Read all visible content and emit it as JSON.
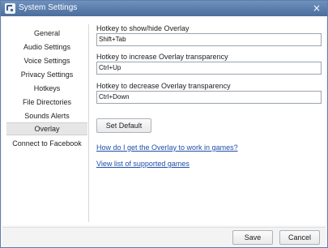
{
  "window": {
    "title": "System Settings",
    "close_glyph": "×",
    "app_icon": "app-logo-icon"
  },
  "sidebar": {
    "items": [
      {
        "label": "General"
      },
      {
        "label": "Audio Settings"
      },
      {
        "label": "Voice Settings"
      },
      {
        "label": "Privacy Settings"
      },
      {
        "label": "Hotkeys"
      },
      {
        "label": "File Directories"
      },
      {
        "label": "Sounds Alerts"
      },
      {
        "label": "Overlay"
      },
      {
        "label": "Connect to Facebook"
      }
    ],
    "selected": "Overlay"
  },
  "overlay": {
    "show_hide_label": "Hotkey to show/hide Overlay",
    "show_hide_value": "Shift+Tab",
    "increase_label": "Hotkey to increase Overlay transparency",
    "increase_value": "Ctrl+Up",
    "decrease_label": "Hotkey to decrease Overlay transparency",
    "decrease_value": "Ctrl+Down",
    "set_default_label": "Set Default",
    "help_link": "How do I get the Overlay to work in games?",
    "games_link": "View list of supported games"
  },
  "footer": {
    "save_label": "Save",
    "cancel_label": "Cancel"
  },
  "colors": {
    "titlebar": "#5a7eae",
    "link": "#1f4fa8",
    "selected_item_bg": "#e6e6e6"
  }
}
